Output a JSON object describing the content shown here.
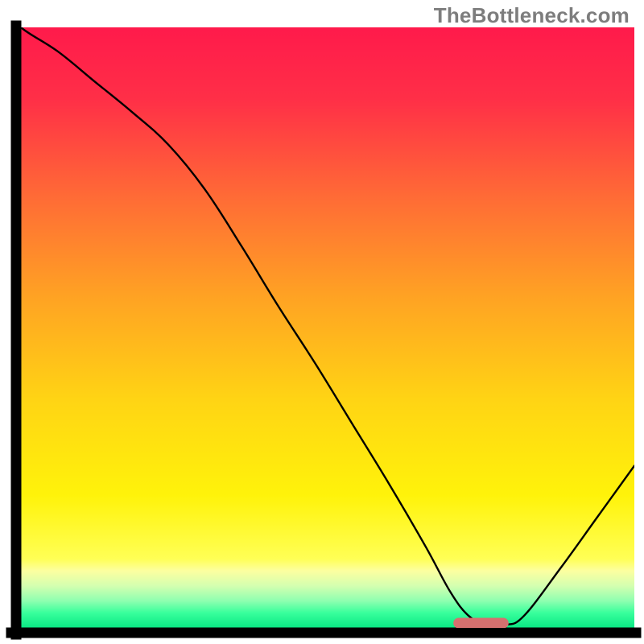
{
  "watermark": "TheBottleneck.com",
  "chart_data": {
    "type": "line",
    "title": "",
    "xlabel": "",
    "ylabel": "",
    "xlim": [
      0,
      100
    ],
    "ylim": [
      0,
      100
    ],
    "grid": false,
    "legend": false,
    "gradient_stops": [
      {
        "offset": 0.0,
        "color": "#ff1a4b"
      },
      {
        "offset": 0.12,
        "color": "#ff2f47"
      },
      {
        "offset": 0.28,
        "color": "#ff6a36"
      },
      {
        "offset": 0.45,
        "color": "#ffa323"
      },
      {
        "offset": 0.62,
        "color": "#ffd414"
      },
      {
        "offset": 0.78,
        "color": "#fff30a"
      },
      {
        "offset": 0.885,
        "color": "#ffff55"
      },
      {
        "offset": 0.905,
        "color": "#fcffa0"
      },
      {
        "offset": 0.93,
        "color": "#d4ffb0"
      },
      {
        "offset": 0.955,
        "color": "#8effb0"
      },
      {
        "offset": 0.975,
        "color": "#38ff9c"
      },
      {
        "offset": 1.0,
        "color": "#09e884"
      }
    ],
    "marker": {
      "x_start": 70.5,
      "x_end": 79.5,
      "y": 0.8,
      "color": "#d6706f"
    },
    "series": [
      {
        "name": "bottleneck-curve",
        "color": "#000000",
        "stroke_width": 2.4,
        "x": [
          0,
          6,
          12,
          18,
          24,
          30,
          36,
          42,
          48,
          54,
          60,
          66,
          70,
          73,
          76,
          79,
          82,
          88,
          94,
          100
        ],
        "y": [
          100,
          96,
          91,
          86,
          80.5,
          73,
          63.5,
          53.5,
          44,
          34,
          24,
          13.5,
          6,
          2,
          0.5,
          0.5,
          2,
          10,
          18.5,
          27
        ]
      }
    ]
  }
}
